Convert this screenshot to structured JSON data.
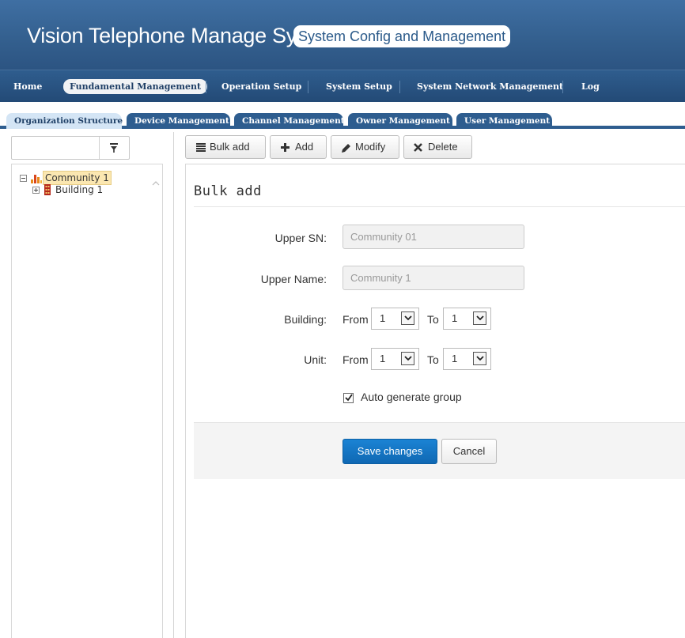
{
  "app": {
    "title": "Vision Telephone Manage System",
    "subtitle": "System Config and Management"
  },
  "nav": {
    "items": [
      "Home",
      "Fundamental Management",
      "Operation Setup",
      "System Setup",
      "System Network Management",
      "Log"
    ],
    "active": "Fundamental Management"
  },
  "subtabs": {
    "items": [
      "Organization Structure",
      "Device Management",
      "Channel Management",
      "Owner Management",
      "User Management"
    ],
    "active": "Organization Structure"
  },
  "tree": {
    "root": "Community 1",
    "children": [
      "Building 1"
    ]
  },
  "toolbar": {
    "bulk_add": "Bulk add",
    "add": "Add",
    "modify": "Modify",
    "delete": "Delete"
  },
  "form": {
    "title": "Bulk add",
    "upper_sn_label": "Upper SN:",
    "upper_sn_value": "Community 01",
    "upper_name_label": "Upper Name:",
    "upper_name_value": "Community 1",
    "building_label": "Building:",
    "unit_label": "Unit:",
    "from_label": "From",
    "to_label": "To",
    "building_from": "1",
    "building_to": "1",
    "unit_from": "1",
    "unit_to": "1",
    "auto_generate_label": "Auto generate group",
    "auto_generate_checked": true,
    "save_label": "Save changes",
    "cancel_label": "Cancel"
  },
  "colors": {
    "header": "#34608f",
    "primary_button": "#1575c4",
    "tab_active": "#d4e5f5"
  }
}
